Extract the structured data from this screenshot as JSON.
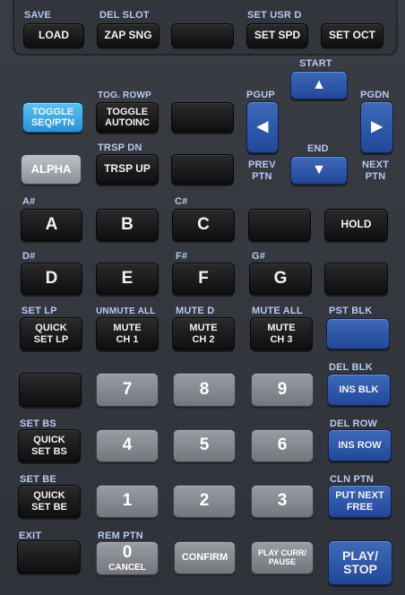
{
  "labels": {
    "save": "SAVE",
    "del_slot": "DEL SLOT",
    "set_usr_d": "SET USR D",
    "start": "START",
    "tog_rowp": "TOG. ROWP",
    "pgup": "PGUP",
    "pgdn": "PGDN",
    "trsp_dn": "TRSP DN",
    "end": "END",
    "prev_ptn": "PREV\nPTN",
    "next_ptn": "NEXT\nPTN",
    "a_sharp": "A#",
    "c_sharp": "C#",
    "d_sharp": "D#",
    "f_sharp": "F#",
    "g_sharp": "G#",
    "set_lp": "SET LP",
    "unmute_all": "UNMUTE ALL",
    "mute_d": "MUTE D",
    "mute_all": "MUTE ALL",
    "pst_blk": "PST BLK",
    "del_blk": "DEL BLK",
    "set_bs": "SET BS",
    "del_row": "DEL ROW",
    "set_be": "SET BE",
    "cln_ptn": "CLN PTN",
    "exit": "EXIT",
    "rem_ptn": "REM PTN"
  },
  "keys": {
    "load": "LOAD",
    "zap_sng": "ZAP SNG",
    "set_spd": "SET SPD",
    "set_oct": "SET OCT",
    "toggle_seq_1": "TOGGLE",
    "toggle_seq_2": "SEQ/PTN",
    "toggle_auto_1": "TOGGLE",
    "toggle_auto_2": "AUTOINC",
    "alpha": "ALPHA",
    "trsp_up": "TRSP UP",
    "a": "A",
    "b": "B",
    "c": "C",
    "hold": "HOLD",
    "d": "D",
    "e": "E",
    "f": "F",
    "g": "G",
    "quick_lp_1": "QUICK",
    "quick_lp_2": "SET LP",
    "mute1_1": "MUTE",
    "mute1_2": "CH 1",
    "mute2_1": "MUTE",
    "mute2_2": "CH 2",
    "mute3_1": "MUTE",
    "mute3_2": "CH 3",
    "n7": "7",
    "n8": "8",
    "n9": "9",
    "ins_blk": "INS BLK",
    "quick_bs_1": "QUICK",
    "quick_bs_2": "SET BS",
    "n4": "4",
    "n5": "5",
    "n6": "6",
    "ins_row": "INS ROW",
    "quick_be_1": "QUICK",
    "quick_be_2": "SET BE",
    "n1": "1",
    "n2": "2",
    "n3": "3",
    "put_next_1": "PUT NEXT",
    "put_next_2": "FREE",
    "n0": "0",
    "cancel": "CANCEL",
    "confirm": "CONFIRM",
    "play_curr_1": "PLAY CURR/",
    "play_curr_2": "PAUSE",
    "play_stop_1": "PLAY/",
    "play_stop_2": "STOP"
  },
  "icons": {
    "up": "▲",
    "down": "▼",
    "left": "◀",
    "right": "▶"
  }
}
